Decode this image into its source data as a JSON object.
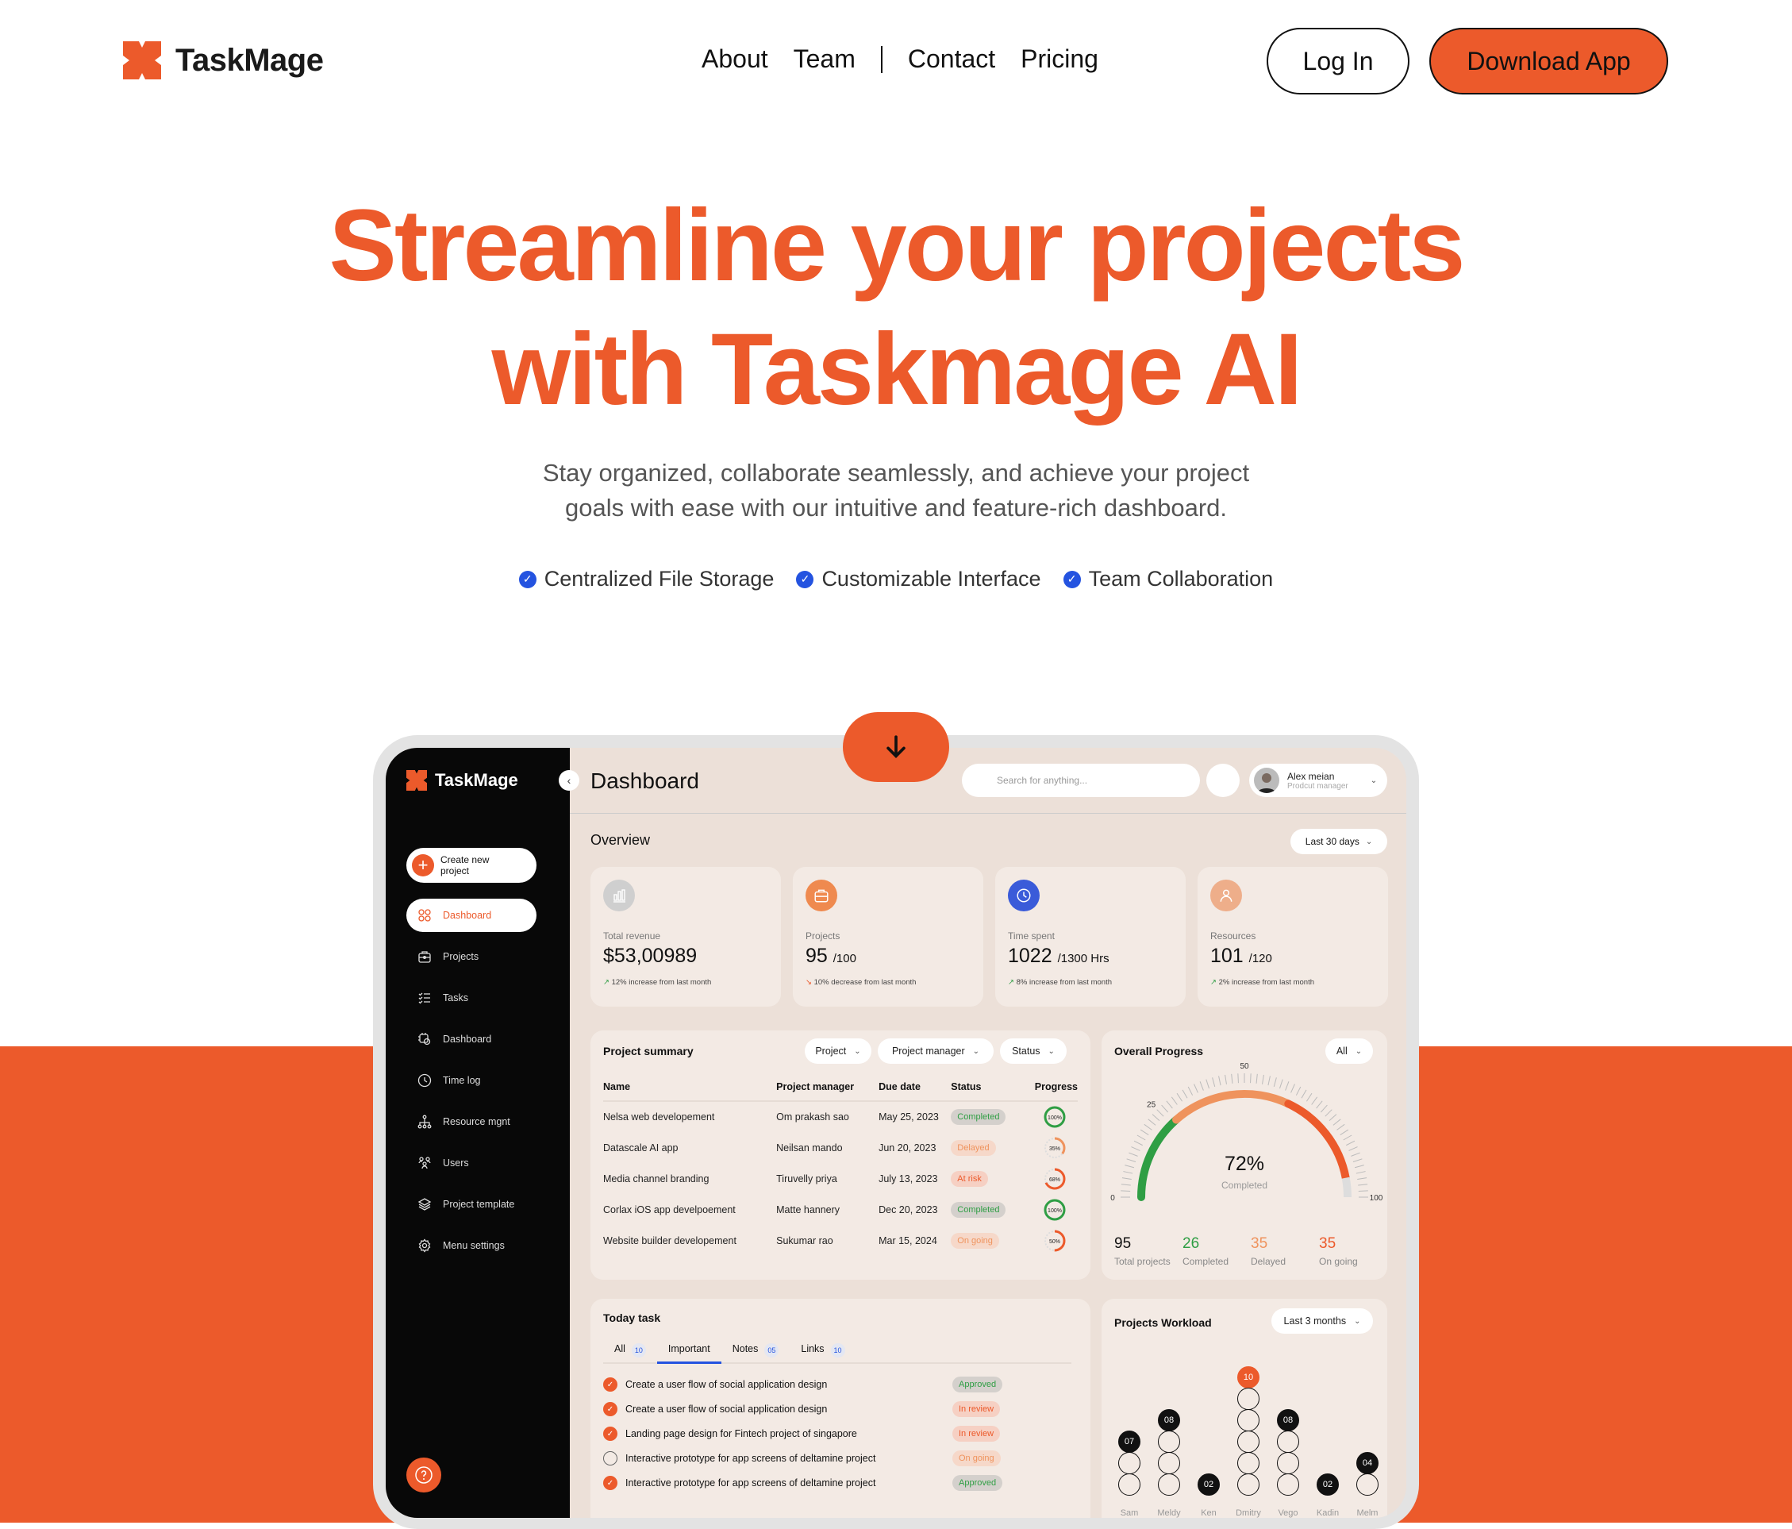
{
  "brand": {
    "name": "TaskMage",
    "accent": "#ec5a2b",
    "blue": "#2453e0",
    "green": "#2f9e44"
  },
  "nav": {
    "links": [
      "About",
      "Team",
      "Contact",
      "Pricing"
    ],
    "login": "Log In",
    "download": "Download App"
  },
  "hero": {
    "title_line1": "Streamline your projects",
    "title_line2": "with Taskmage AI",
    "subtitle_line1": "Stay organized, collaborate seamlessly, and achieve your project",
    "subtitle_line2": "goals with ease  with our intuitive and feature-rich dashboard.",
    "features": [
      "Centralized File Storage",
      "Customizable Interface",
      "Team Collaboration"
    ]
  },
  "app": {
    "logo": "TaskMage",
    "create_button": "Create new project",
    "sidebar": [
      {
        "label": "Dashboard",
        "icon": "grid-icon",
        "active": true
      },
      {
        "label": "Projects",
        "icon": "briefcase-icon"
      },
      {
        "label": "Tasks",
        "icon": "checklist-icon"
      },
      {
        "label": "Dashboard",
        "icon": "cpu-gear-icon"
      },
      {
        "label": "Time log",
        "icon": "clock-icon"
      },
      {
        "label": "Resource mgnt",
        "icon": "hierarchy-icon"
      },
      {
        "label": "Users",
        "icon": "users-icon"
      },
      {
        "label": "Project template",
        "icon": "layers-icon"
      },
      {
        "label": "Menu settings",
        "icon": "gear-icon"
      }
    ],
    "header": {
      "title": "Dashboard",
      "search_placeholder": "Search for anything...",
      "user_name": "Alex meian",
      "user_role": "Prodcut manager"
    },
    "overview": {
      "title": "Overview",
      "range": "Last 30 days",
      "stats": [
        {
          "label": "Total revenue",
          "value": "$53,00989",
          "suffix": "",
          "note": "12% increase from last month",
          "trend": "up",
          "color": "#cfcfcf"
        },
        {
          "label": "Projects",
          "value": "95",
          "suffix": "/100",
          "note": "10% decrease from last month",
          "trend": "down",
          "color": "#ef8a4f"
        },
        {
          "label": "Time spent",
          "value": "1022",
          "suffix": "/1300 Hrs",
          "note": "8% increase from last month",
          "trend": "up",
          "color": "#3a5bd9"
        },
        {
          "label": "Resources",
          "value": "101",
          "suffix": "/120",
          "note": "2% increase from last month",
          "trend": "up",
          "color": "#eeae8a"
        }
      ]
    },
    "project_summary": {
      "title": "Project summary",
      "filters": [
        "Project",
        "Project manager",
        "Status"
      ],
      "columns": [
        "Name",
        "Project manager",
        "Due date",
        "Status",
        "Progress"
      ],
      "rows": [
        {
          "name": "Nelsa web developement",
          "manager": "Om prakash sao",
          "due": "May 25, 2023",
          "status": "Completed",
          "progress": 100
        },
        {
          "name": "Datascale AI app",
          "manager": "Neilsan mando",
          "due": "Jun 20, 2023",
          "status": "Delayed",
          "progress": 35
        },
        {
          "name": "Media channel branding",
          "manager": "Tiruvelly priya",
          "due": "July 13, 2023",
          "status": "At risk",
          "progress": 68
        },
        {
          "name": "Corlax iOS app develpoement",
          "manager": "Matte hannery",
          "due": "Dec 20, 2023",
          "status": "Completed",
          "progress": 100
        },
        {
          "name": "Website builder developement",
          "manager": "Sukumar rao",
          "due": "Mar 15, 2024",
          "status": "On going",
          "progress": 50
        }
      ]
    },
    "overall_progress": {
      "title": "Overall Progress",
      "filter": "All",
      "percent": "72%",
      "percent_label": "Completed",
      "gauge_ticks": [
        "0",
        "25",
        "50",
        "100"
      ],
      "segments": [
        {
          "name": "Completed",
          "fraction": 0.27,
          "color": "#2f9e44"
        },
        {
          "name": "Delayed",
          "fraction": 0.37,
          "color": "#ef935d"
        },
        {
          "name": "On going",
          "fraction": 0.3,
          "color": "#ec5a2b"
        }
      ],
      "stats": [
        {
          "value": "95",
          "label": "Total projects",
          "color": "#111"
        },
        {
          "value": "26",
          "label": "Completed",
          "color": "#2f9e44"
        },
        {
          "value": "35",
          "label": "Delayed",
          "color": "#ef935d"
        },
        {
          "value": "35",
          "label": "On going",
          "color": "#ec5a2b"
        }
      ]
    },
    "today_task": {
      "title": "Today task",
      "tabs": [
        {
          "label": "All",
          "count": "10"
        },
        {
          "label": "Important",
          "count": "",
          "active": true
        },
        {
          "label": "Notes",
          "count": "05"
        },
        {
          "label": "Links",
          "count": "10"
        }
      ],
      "tasks": [
        {
          "text": "Create a user flow of social application design",
          "done": true,
          "status": "Approved"
        },
        {
          "text": "Create a user flow of social application design",
          "done": true,
          "status": "In review"
        },
        {
          "text": "Landing page design for Fintech project of singapore",
          "done": true,
          "status": "In review"
        },
        {
          "text": "Interactive prototype for app screens of deltamine project",
          "done": false,
          "status": "On going"
        },
        {
          "text": "Interactive prototype for app screens of deltamine project",
          "done": true,
          "status": "Approved"
        }
      ]
    },
    "workload": {
      "title": "Projects Workload",
      "range": "Last 3 months",
      "people": [
        {
          "name": "Sam",
          "value": "07",
          "bubbles": 3
        },
        {
          "name": "Meldy",
          "value": "08",
          "bubbles": 4
        },
        {
          "name": "Ken",
          "value": "02",
          "bubbles": 1
        },
        {
          "name": "Dmitry",
          "value": "10",
          "bubbles": 6,
          "highlight": true
        },
        {
          "name": "Vego",
          "value": "08",
          "bubbles": 4
        },
        {
          "name": "Kadin",
          "value": "02",
          "bubbles": 1
        },
        {
          "name": "Melm",
          "value": "04",
          "bubbles": 2
        }
      ]
    }
  }
}
